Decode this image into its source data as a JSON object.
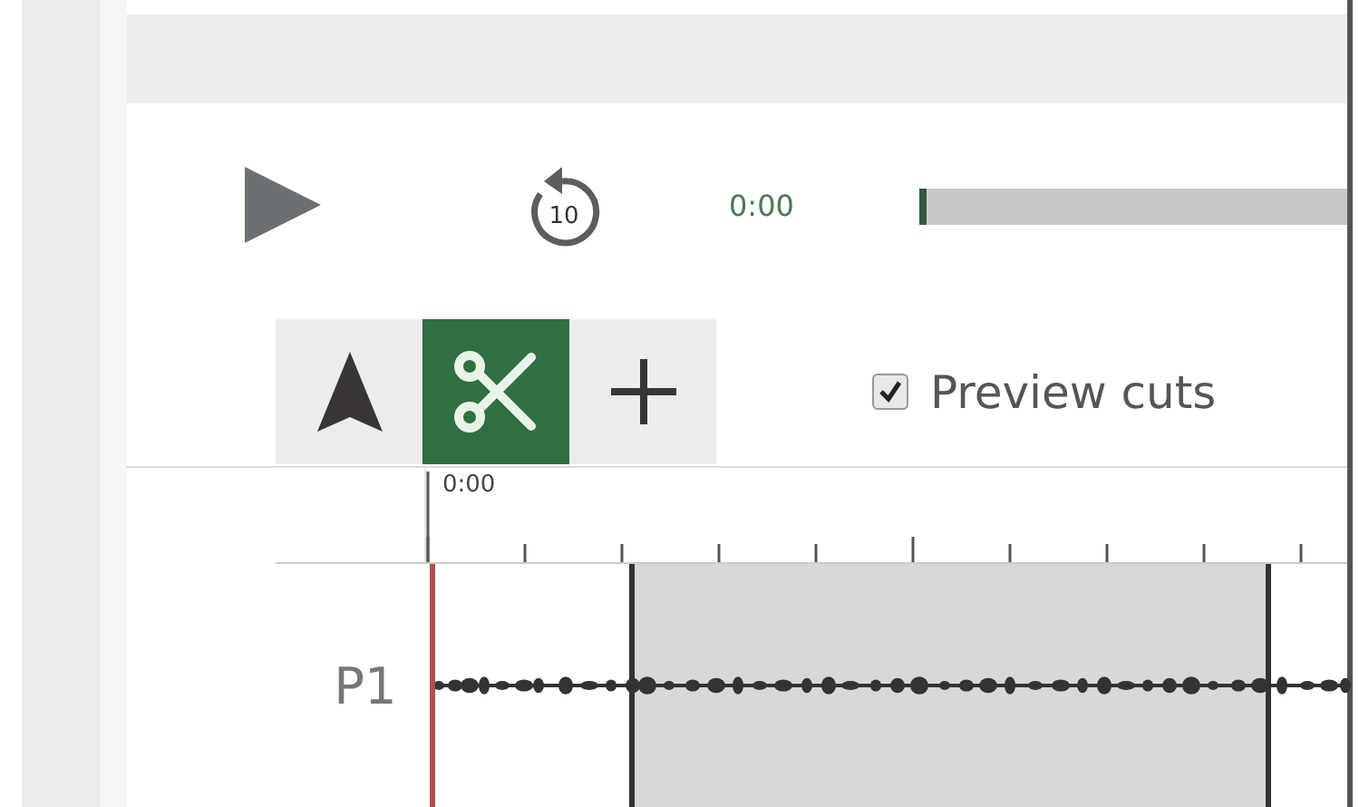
{
  "player": {
    "skip_label": "10",
    "time": "0:00",
    "progress": {
      "level": 0.02
    }
  },
  "tools": [
    {
      "kind": "arrow",
      "selected": false
    },
    {
      "kind": "scissors",
      "selected": true
    },
    {
      "kind": "plus",
      "selected": false
    }
  ],
  "preview_cuts": {
    "label": "Preview cuts",
    "checked": true
  },
  "ruler": {
    "start_label": "0:00"
  },
  "tracks": [
    {
      "label": "P1"
    }
  ]
}
